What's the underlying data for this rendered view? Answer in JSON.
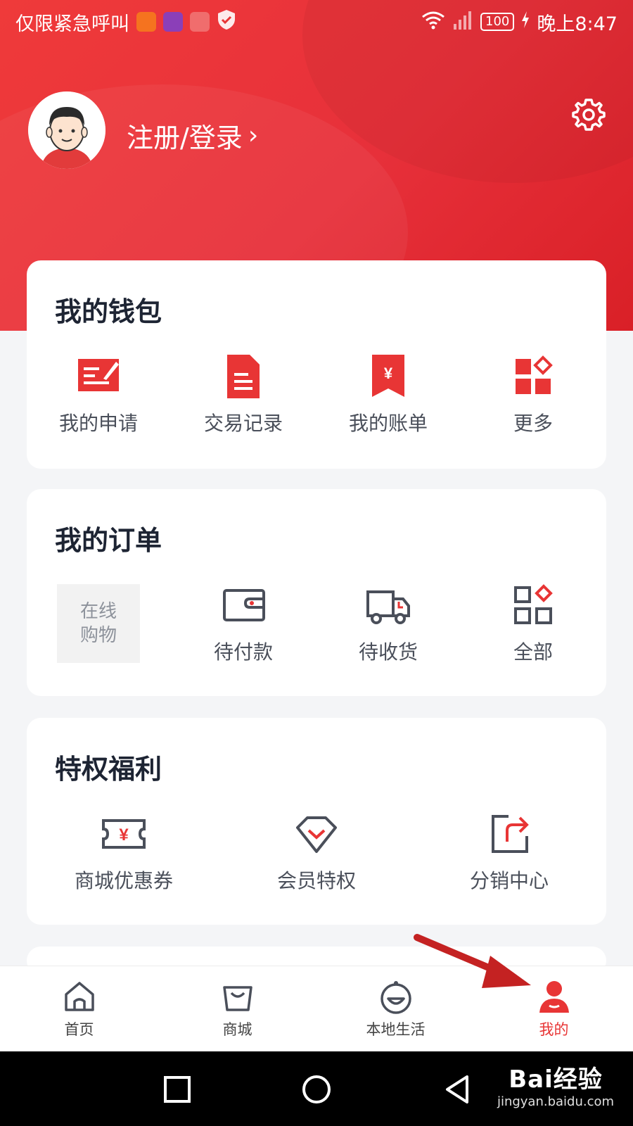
{
  "status_bar": {
    "carrier_text": "仅限紧急呼叫",
    "battery": "100",
    "time": "晚上8:47"
  },
  "profile": {
    "login_label": "注册/登录",
    "chevron": "›"
  },
  "wallet": {
    "title": "我的钱包",
    "items": [
      {
        "label": "我的申请",
        "icon": "application-icon"
      },
      {
        "label": "交易记录",
        "icon": "transaction-record-icon"
      },
      {
        "label": "我的账单",
        "icon": "bill-icon"
      },
      {
        "label": "更多",
        "icon": "more-grid-icon"
      }
    ]
  },
  "orders": {
    "title": "我的订单",
    "placeholder_text": "在线购物",
    "items": [
      {
        "label": "待付款",
        "icon": "wallet-icon"
      },
      {
        "label": "待收货",
        "icon": "truck-icon"
      },
      {
        "label": "全部",
        "icon": "all-grid-icon"
      }
    ]
  },
  "perks": {
    "title": "特权福利",
    "items": [
      {
        "label": "商城优惠券",
        "icon": "coupon-icon"
      },
      {
        "label": "会员特权",
        "icon": "diamond-icon"
      },
      {
        "label": "分销中心",
        "icon": "share-icon"
      }
    ]
  },
  "bottom_nav": {
    "items": [
      {
        "label": "首页",
        "icon": "home-icon",
        "active": false
      },
      {
        "label": "商城",
        "icon": "shopping-bag-icon",
        "active": false
      },
      {
        "label": "本地生活",
        "icon": "local-life-icon",
        "active": false
      },
      {
        "label": "我的",
        "icon": "profile-icon",
        "active": true
      }
    ]
  },
  "watermark": {
    "brand": "Bai经验",
    "url": "jingyan.baidu.com"
  },
  "colors": {
    "brand_red": "#e83535",
    "icon_gray": "#4a4f5a",
    "background": "#f4f5f7"
  }
}
